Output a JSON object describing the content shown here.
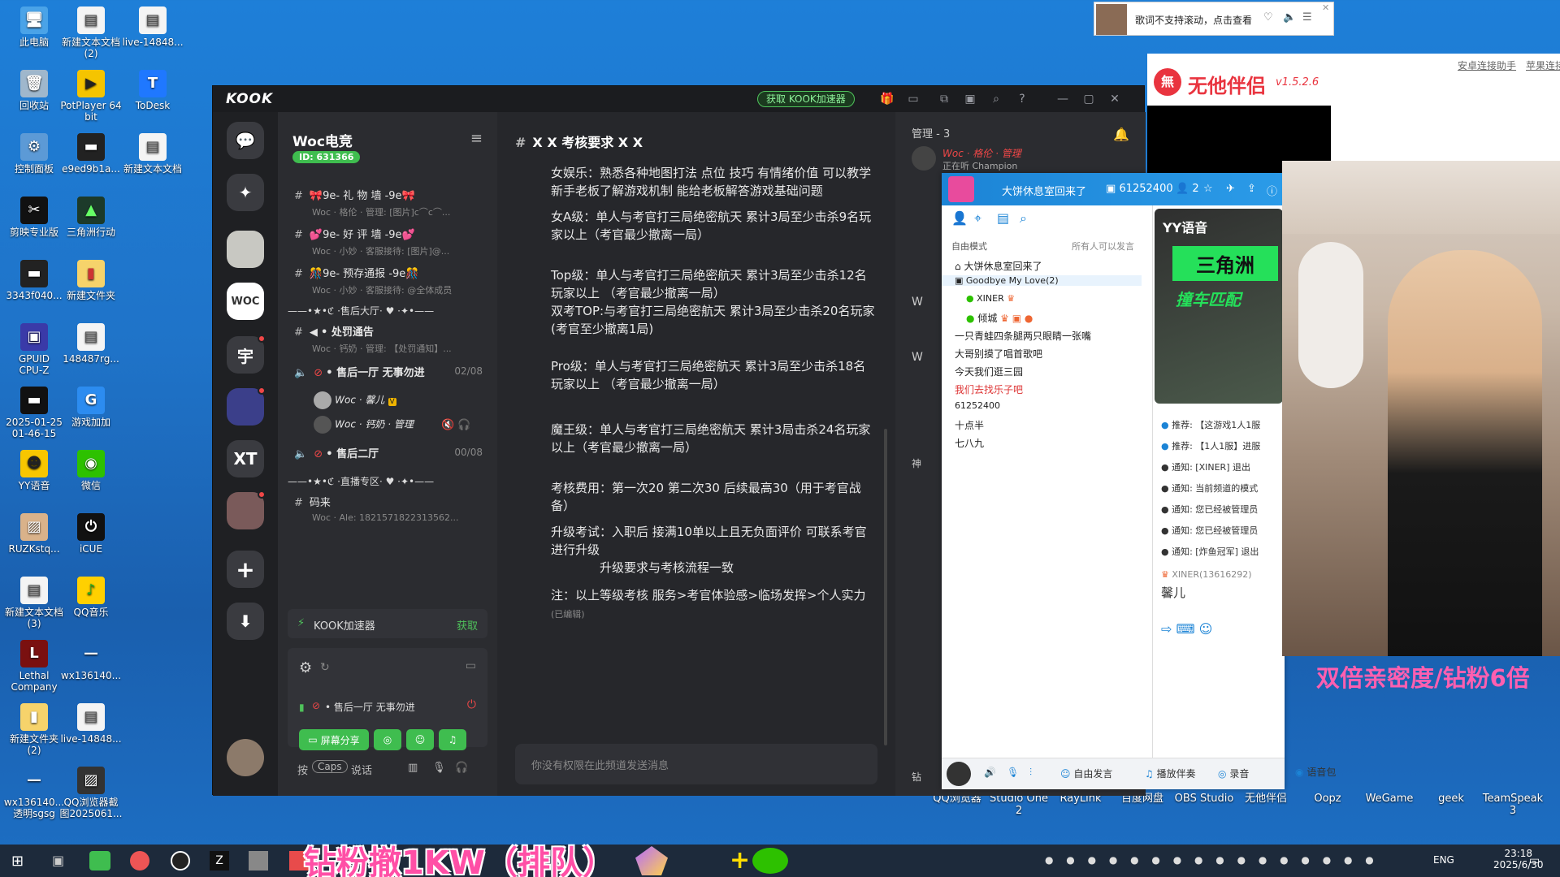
{
  "desktop": {
    "icons": [
      {
        "label": "此电脑"
      },
      {
        "label": "新建文本文档\n(2)"
      },
      {
        "label": "live-14848..."
      },
      {
        "label": "回收站"
      },
      {
        "label": "PotPlayer 64\nbit"
      },
      {
        "label": "ToDesk"
      },
      {
        "label": "控制面板"
      },
      {
        "label": "e9ed9b1a..."
      },
      {
        "label": "新建文本文档"
      },
      {
        "label": "剪映专业版"
      },
      {
        "label": "三角洲行动"
      },
      {
        "label": "3343f040..."
      },
      {
        "label": "新建文件夹"
      },
      {
        "label": "GPUID\nCPU-Z"
      },
      {
        "label": "148487rg..."
      },
      {
        "label": "2025-01-25\n01-46-15"
      },
      {
        "label": "游戏加加"
      },
      {
        "label": "YY语音"
      },
      {
        "label": "微信"
      },
      {
        "label": "RUZKstq..."
      },
      {
        "label": "iCUE"
      },
      {
        "label": "新建文本文档\n(3)"
      },
      {
        "label": "QQ音乐"
      },
      {
        "label": "Lethal\nCompany"
      },
      {
        "label": "wx136140..."
      },
      {
        "label": "新建文件夹\n(2)"
      },
      {
        "label": "live-14848..."
      },
      {
        "label": "wx136140...\n透明sgsg"
      },
      {
        "label": "QQ浏览器截\n图2025061..."
      }
    ],
    "bottom_row": [
      {
        "label": "QQ浏览器"
      },
      {
        "label": "Studio One\n2"
      },
      {
        "label": "RayLink"
      },
      {
        "label": "百度网盘"
      },
      {
        "label": "OBS Studio"
      },
      {
        "label": "无他伴侣"
      },
      {
        "label": "Oopz"
      },
      {
        "label": "WeGame"
      },
      {
        "label": "geek"
      },
      {
        "label": "TeamSpeak\n3"
      }
    ]
  },
  "music_popup": {
    "text": "歌词不支持滚动，点击查看"
  },
  "companion": {
    "name": "无他伴侣",
    "version": "v1.5.2.6",
    "link1": "安卓连接助手",
    "link2": "苹果连接"
  },
  "kook": {
    "logo": "KOOK",
    "accel_button": "获取 KOOK加速器",
    "server": {
      "name": "Woc电竞",
      "id": "ID: 631366"
    },
    "rail": [
      "XT",
      "宇"
    ],
    "channels": [
      {
        "name": "🎀9e- 礼 物 墙 -9e🎀",
        "sub": "Woc · 格伦 · 管理: [图片]c⌒c⌒..."
      },
      {
        "name": "💕9e- 好 评 墙 -9e💕",
        "sub": "Woc · 小妙 · 客服接待: [图片]@..."
      },
      {
        "name": "🎊9e- 预存通报 -9e🎊",
        "sub": "Woc · 小妙 · 客服接待: @全体成员"
      }
    ],
    "cat1": "——•★•ℭ ·售后大厅· ♥ ·✦•——",
    "ch_punish": {
      "name": "• 处罚通告",
      "sub": "Woc · 钙奶 · 管理: 【处罚通知】..."
    },
    "ch_after1": {
      "name": "• 售后一厅 无事勿进",
      "count": "02/08"
    },
    "voice_users": [
      {
        "name": "Woc · 馨儿"
      },
      {
        "name": "Woc · 钙奶 · 管理"
      }
    ],
    "ch_after2": {
      "name": "• 售后二厅",
      "count": "00/08"
    },
    "cat2": "——•★•ℭ ·直播专区· ♥ ·✦•——",
    "ch_live": {
      "name": "码来",
      "sub": "Woc · Ale: 1821571822313562..."
    },
    "accel_bar": {
      "label": "KOOK加速器",
      "action": "获取"
    },
    "voice_panel": {
      "channel": "• 售后一厅 无事勿进",
      "share": "屏幕分享"
    },
    "talk_hint": {
      "prefix": "按",
      "key": "Caps",
      "suffix": "说话"
    },
    "chat": {
      "title": "X X 考核要求 X X",
      "messages": [
        "女娱乐：熟悉各种地图打法 点位 技巧 有情绪价值 可以教学新手老板了解游戏机制 能给老板解答游戏基础问题",
        "女A级：单人与考官打三局绝密航天 累计3局至少击杀9名玩家以上（考官最少撤离一局）",
        "Top级：单人与考官打三局绝密航天 累计3局至少击杀12名玩家以上 （考官最少撤离一局）",
        "双考TOP:与考官打三局绝密航天 累计3局至少击杀20名玩家(考官至少撤离1局)",
        "Pro级：单人与考官打三局绝密航天 累计3局至少击杀18名玩家以上 （考官最少撤离一局）",
        "魔王级：单人与考官打三局绝密航天 累计3局击杀24名玩家以上（考官最少撤离一局）",
        "考核费用：第一次20 第二次30 后续最高30（用于考官战备）",
        "升级考试：入职后 接满10单以上且无负面评价 可联系考官进行升级",
        "升级要求与考核流程一致",
        "注：以上等级考核 服务>考官体验感>临场发挥>个人实力"
      ],
      "edited": "(已编辑)",
      "input_placeholder": "你没有权限在此频道发送消息"
    },
    "members": {
      "group": "管理 - 3",
      "first": "Woc · 格伦 · 管理",
      "status": "正在听 Champion",
      "w1": "W",
      "w2": "W",
      "w3": "神",
      "w4": "钻"
    }
  },
  "yy": {
    "room_title": "大饼休息室回来了",
    "room_id": "61252400",
    "online": "2",
    "mode": "自由模式",
    "mode_right": "所有人可以发言",
    "channels": [
      "大饼休息室回来了",
      "Goodbye My Love(2)",
      "XINER",
      "倾城",
      "一只青蛙四条腿两只眼睛一张嘴",
      "大哥别摸了唱首歌吧",
      "今天我们逛三园",
      "我们去找乐子吧",
      "61252400",
      "十点半",
      "七八九"
    ],
    "notes": [
      "推荐: 【这游戏1人1服",
      "推荐: 【1人1服】进服",
      "通知: [XINER] 退出",
      "通知: 当前频道的模式",
      "通知: 您已经被管理员",
      "通知: 您已经被管理员",
      "通知: [炸鱼冠军] 退出"
    ],
    "msg_user": "XINER(13616292)",
    "msg_text": "馨儿",
    "ad_brand": "YY语音",
    "ad_line1": "三角洲",
    "ad_line2": "撞车匹配",
    "bottom": {
      "free": "自由发言",
      "accomp": "播放伴奏",
      "record": "录音",
      "voice": "语音包"
    }
  },
  "overlays": {
    "banner": "钻粉撤1KW（排队）",
    "pink": "双倍亲密度/钻粉6倍"
  },
  "taskbar": {
    "time": "23:18",
    "date": "2025/6/30",
    "lang": "ENG"
  }
}
